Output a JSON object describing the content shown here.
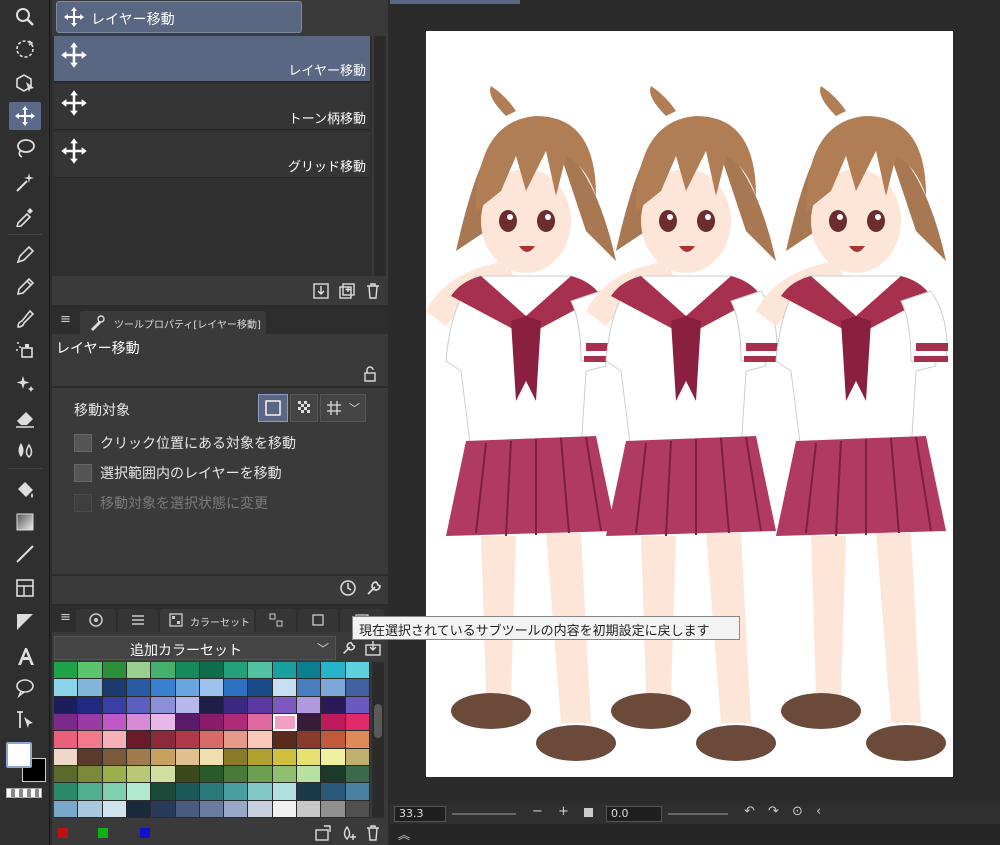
{
  "subtool_panel": {
    "header_label": "レイヤー移動",
    "items": [
      {
        "label": "レイヤー移動",
        "selected": true
      },
      {
        "label": "トーン柄移動",
        "selected": false
      },
      {
        "label": "グリッド移動",
        "selected": false
      }
    ]
  },
  "tool_property": {
    "tab_label": "ツールプロパティ[レイヤー移動]",
    "title": "レイヤー移動",
    "move_target_label": "移動対象",
    "checkboxes": [
      {
        "label": "クリック位置にある対象を移動",
        "checked": false,
        "enabled": true
      },
      {
        "label": "選択範囲内のレイヤーを移動",
        "checked": false,
        "enabled": true
      },
      {
        "label": "移動対象を選択状態に変更",
        "checked": false,
        "enabled": false
      }
    ]
  },
  "color_panel": {
    "tab_label": "カラーセット",
    "selected_set": "追加カラーセット",
    "swatch_rows": [
      [
        "#1fa34a",
        "#5bc46c",
        "#2c8f3a",
        "#9ad08e",
        "#43b06b",
        "#168a5c",
        "#0d6e4f",
        "#22a17a",
        "#52c1a2",
        "#1aa0a0",
        "#0b7f8f",
        "#28b4c8",
        "#5fd0e0"
      ],
      [
        "#8ad3e8",
        "#7fb6d9",
        "#1b3b6f",
        "#2a5ba6",
        "#3b7fd0",
        "#6ba6e0",
        "#9dc3ec",
        "#2d6fc0",
        "#1a4a8a",
        "#c8dff2",
        "#4a7fbf",
        "#7da7d8",
        "#4060a0"
      ],
      [
        "#1a1f5c",
        "#202a80",
        "#3a3fa8",
        "#5a5fc0",
        "#8b8fd8",
        "#b8b9ea",
        "#1e1e4a",
        "#3c2a80",
        "#5a3aa0",
        "#7d58c0",
        "#b09be0",
        "#2a1a5a",
        "#6a5ac0"
      ],
      [
        "#7a2a8a",
        "#9a3aa6",
        "#c258c8",
        "#d88ad8",
        "#e9b8e8",
        "#5a1a6a",
        "#8a1a6a",
        "#b02a7a",
        "#e06aa0",
        "#f0a0c0",
        "#3a1a3a",
        "#c01a5a",
        "#e02a6a"
      ],
      [
        "#e8607a",
        "#f07a8a",
        "#f8b0b8",
        "#6a1a2a",
        "#8a2a3a",
        "#b03a4a",
        "#d86a6a",
        "#e89a8a",
        "#f8c8b8",
        "#5a2a1a",
        "#8a3a2a",
        "#c05a3a",
        "#e08a5a"
      ],
      [
        "#f0d8c8",
        "#5a3a2a",
        "#7a5a3a",
        "#a07a4a",
        "#c8a060",
        "#e0c090",
        "#f0e0b0",
        "#8a7a2a",
        "#b0a030",
        "#d0c040",
        "#e8e070",
        "#f0f0a0",
        "#c0b070"
      ],
      [
        "#5a6a2a",
        "#7a8a3a",
        "#9ab04a",
        "#b8c870",
        "#d0e0a0",
        "#3a4a1a",
        "#2a5a2a",
        "#4a7a3a",
        "#6aa050",
        "#90c070",
        "#b8e0a0",
        "#1a3a2a",
        "#3a6a4a"
      ],
      [
        "#2a8a6a",
        "#50b090",
        "#80d0b0",
        "#b0e8d0",
        "#1a4a3a",
        "#1a5a5a",
        "#2a7a7a",
        "#4aa0a0",
        "#80c8c8",
        "#b0e0e0",
        "#1a3a4a",
        "#2a5a7a",
        "#4a80a0"
      ],
      [
        "#7aa8c8",
        "#a8c8e0",
        "#d0e4f0",
        "#1a2a3a",
        "#2a3a5a",
        "#4a5a80",
        "#6a7aa0",
        "#9aa8c8",
        "#c8d0e0",
        "#f0f0f0",
        "#c8c8c8",
        "#909090",
        "#505050"
      ]
    ],
    "selected_swatch_index": [
      3,
      9
    ]
  },
  "status_bar": {
    "zoom": "33.3",
    "angle": "0.0"
  },
  "tooltip": "現在選択されているサブツールの内容を初期設定に戻します",
  "colors": {
    "accent": "#5a6782",
    "panel": "#3a3a3a",
    "background": "#2b2b2b",
    "foreground_color": "#ffffff",
    "background_color": "#000000"
  }
}
